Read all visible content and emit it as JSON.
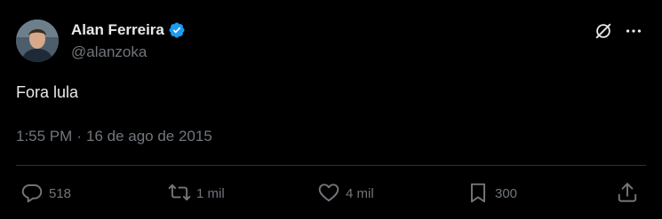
{
  "author": {
    "name": "Alan Ferreira",
    "handle": "@alanzoka",
    "verified_color": "#1d9bf0"
  },
  "tweet": {
    "text": "Fora lula",
    "time": "1:55 PM",
    "separator": "·",
    "date": "16 de ago de 2015"
  },
  "actions": {
    "replies": "518",
    "retweets": "1 mil",
    "likes": "4 mil",
    "bookmarks": "300"
  },
  "icons": {
    "grok": "grok-icon",
    "more": "more-icon",
    "reply": "reply-icon",
    "retweet": "retweet-icon",
    "like": "heart-icon",
    "bookmark": "bookmark-icon",
    "share": "share-icon"
  },
  "colors": {
    "background": "#000000",
    "primary_text": "#e7e9ea",
    "secondary_text": "#71767b",
    "divider": "#2f3336"
  }
}
